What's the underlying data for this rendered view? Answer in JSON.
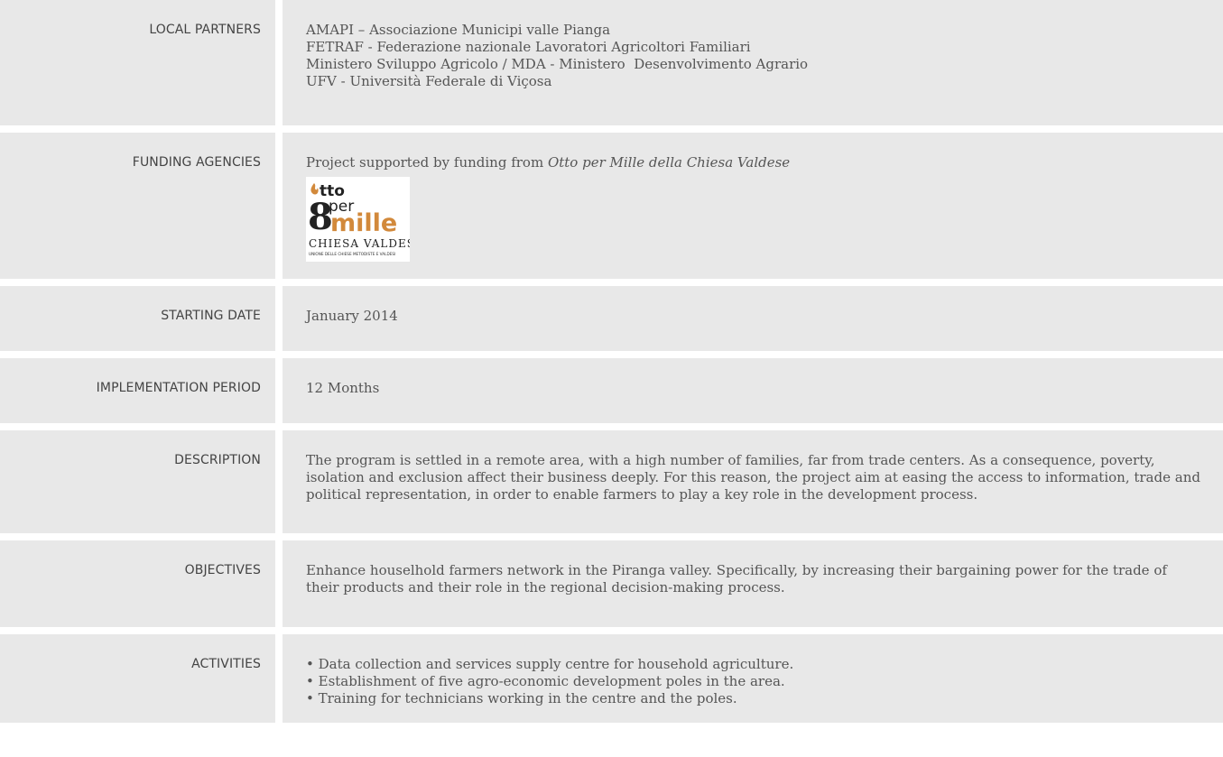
{
  "rows": {
    "local_partners": {
      "label": "LOCAL PARTNERS",
      "lines": [
        "AMAPI – Associazione Municipi valle Pianga",
        "FETRAF - Federazione nazionale Lavoratori Agricoltori Familiari",
        "Ministero Sviluppo Agricolo / MDA - Ministero  Desenvolvimento Agrario",
        "UFV - Università Federale di Viçosa"
      ]
    },
    "funding_agencies": {
      "label": "FUNDING AGENCIES",
      "text_prefix": "Project supported by funding from ",
      "text_italic": "Otto per Mille della Chiesa Valdese",
      "logo": {
        "word_otto": "tto",
        "word_per": "per",
        "word_mille": "mille",
        "numeral": "8",
        "org": "CHIESA VALDESE",
        "sub": "UNIONE DELLE CHIESE METODISTE E VALDESI",
        "accent_color": "#d2893b"
      }
    },
    "starting_date": {
      "label": "STARTING DATE",
      "value": "January 2014"
    },
    "implementation_period": {
      "label": "IMPLEMENTATION PERIOD",
      "value": "12 Months"
    },
    "description": {
      "label": "DESCRIPTION",
      "value": "The program is settled in a remote area, with a high number of families, far from trade centers. As a consequence, poverty, isolation and exclusion affect their business deeply. For this reason, the project aim at easing the access to information, trade and political representation, in order to enable farmers to play a key role in the development process."
    },
    "objectives": {
      "label": "OBJECTIVES",
      "value": "Enhance houselhold farmers network in the Piranga valley. Specifically, by increasing their bargaining power for the trade of their products and their role in the regional decision-making process."
    },
    "activities": {
      "label": "ACTIVITIES",
      "lines": [
        "• Data collection and services supply centre for household agriculture.",
        "• Establishment of five agro-economic development poles in the area.",
        "• Training for technicians working in the centre and the poles."
      ]
    }
  }
}
